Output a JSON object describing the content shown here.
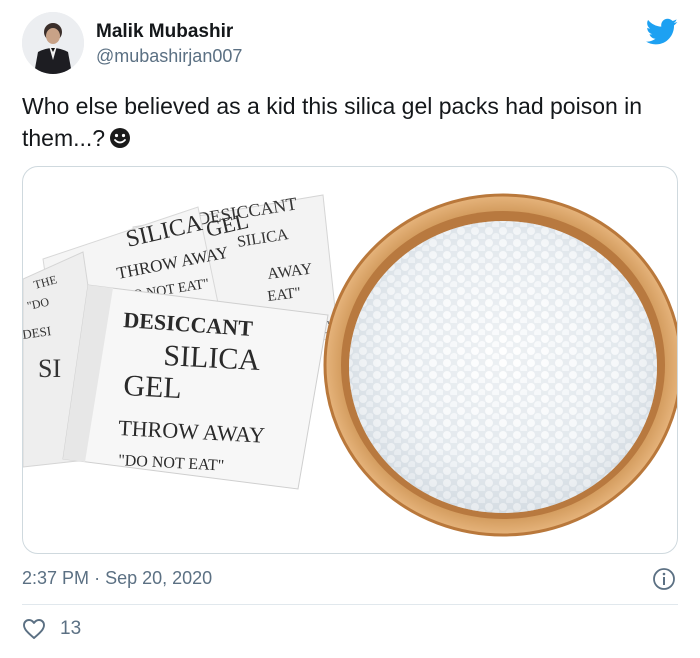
{
  "author": {
    "name": "Malik Mubashir",
    "handle": "@mubashirjan007"
  },
  "tweet": {
    "text": "Who else believed as a kid this silica gel packs had poison in them...?",
    "emoji": "slightly-smiling-face"
  },
  "media": {
    "packets": [
      {
        "line1": "DESICCANT",
        "line2": "SILICA GEL",
        "line3": "THROW AWAY",
        "line4": "\"DO NOT EAT\""
      }
    ],
    "front_packet": {
      "line1": "DESICCANT",
      "line2": "SILICA",
      "line3": "GEL",
      "line4": "THROW AWAY",
      "line5": "\"DO NOT EAT\""
    },
    "bowl_color": "#d9a66a",
    "beads_color": "#f4f6f8"
  },
  "footer": {
    "time": "2:37 PM",
    "separator": "·",
    "date": "Sep 20, 2020",
    "likes": "13"
  },
  "colors": {
    "twitter_blue": "#1da1f2",
    "text": "#14171a",
    "muted": "#5b7083"
  },
  "icons": {
    "logo": "twitter-bird-icon",
    "info": "info-icon",
    "like": "heart-icon"
  }
}
